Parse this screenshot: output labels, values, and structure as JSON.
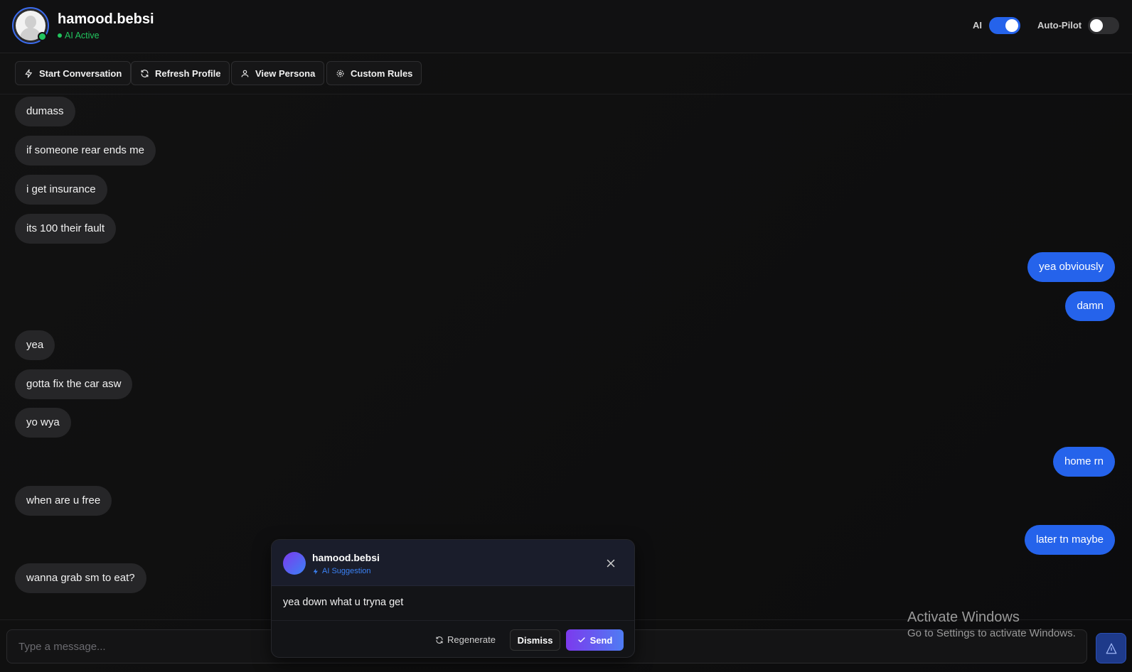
{
  "header": {
    "username": "hamood.bebsi",
    "status": "AI Active",
    "ai_toggle": {
      "label": "AI",
      "on": true
    },
    "autopilot_toggle": {
      "label": "Auto-Pilot",
      "on": false
    }
  },
  "toolbar": {
    "start_conversation": "Start Conversation",
    "refresh_profile": "Refresh Profile",
    "view_persona": "View Persona",
    "custom_rules": "Custom Rules"
  },
  "messages": [
    {
      "side": "in",
      "text": "dumass"
    },
    {
      "side": "in",
      "text": "if someone rear ends me"
    },
    {
      "side": "in",
      "text": "i get insurance"
    },
    {
      "side": "in",
      "text": "its 100 their fault"
    },
    {
      "side": "out",
      "text": "yea obviously"
    },
    {
      "side": "out",
      "text": "damn"
    },
    {
      "side": "in",
      "text": "yea"
    },
    {
      "side": "in",
      "text": "gotta fix the car asw"
    },
    {
      "side": "in",
      "text": "yo wya"
    },
    {
      "side": "out",
      "text": "home rn"
    },
    {
      "side": "in",
      "text": "when are u free"
    },
    {
      "side": "out",
      "text": "later tn maybe"
    },
    {
      "side": "in",
      "text": "wanna grab sm to eat?"
    }
  ],
  "composer": {
    "placeholder": "Type a message..."
  },
  "suggestion": {
    "name": "hamood.bebsi",
    "tag": "AI Suggestion",
    "text": "yea down what u tryna get",
    "regenerate": "Regenerate",
    "dismiss": "Dismiss",
    "send": "Send"
  },
  "watermark": {
    "title": "Activate Windows",
    "subtitle": "Go to Settings to activate Windows."
  },
  "colors": {
    "accent": "#2563eb",
    "online": "#22c55e",
    "incoming_bubble": "#262628",
    "suggestion_gradient_start": "#7c3aed"
  }
}
